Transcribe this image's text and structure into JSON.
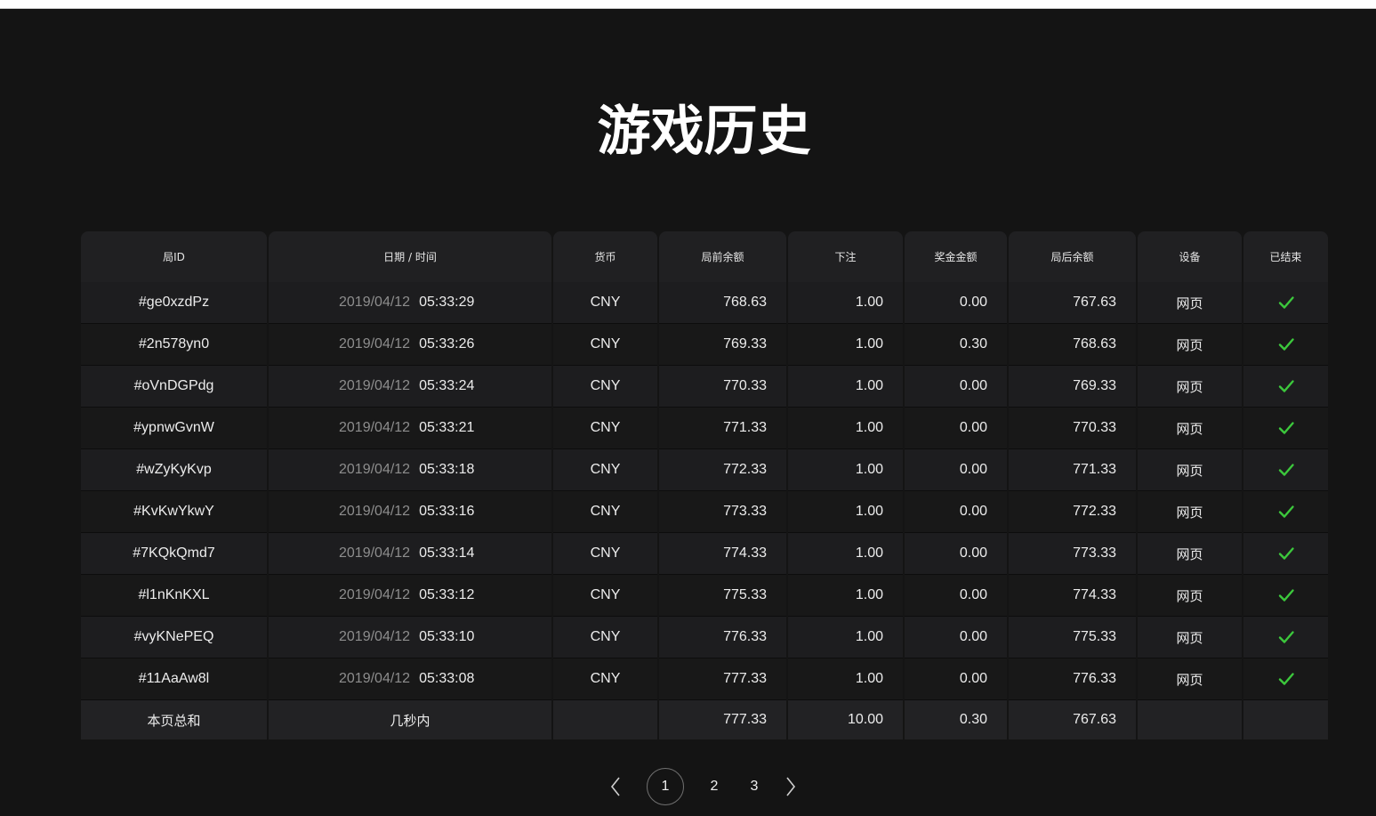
{
  "page": {
    "title": "游戏历史"
  },
  "table": {
    "headers": [
      "局ID",
      "日期 / 时间",
      "货币",
      "局前余额",
      "下注",
      "奖金金额",
      "局后余额",
      "设备",
      "已结束"
    ],
    "rows": [
      {
        "id": "#ge0xzdPz",
        "date": "2019/04/12",
        "time": "05:33:29",
        "currency": "CNY",
        "before": "768.63",
        "bet": "1.00",
        "win": "0.00",
        "after": "767.63",
        "device": "网页"
      },
      {
        "id": "#2n578yn0",
        "date": "2019/04/12",
        "time": "05:33:26",
        "currency": "CNY",
        "before": "769.33",
        "bet": "1.00",
        "win": "0.30",
        "after": "768.63",
        "device": "网页"
      },
      {
        "id": "#oVnDGPdg",
        "date": "2019/04/12",
        "time": "05:33:24",
        "currency": "CNY",
        "before": "770.33",
        "bet": "1.00",
        "win": "0.00",
        "after": "769.33",
        "device": "网页"
      },
      {
        "id": "#ypnwGvnW",
        "date": "2019/04/12",
        "time": "05:33:21",
        "currency": "CNY",
        "before": "771.33",
        "bet": "1.00",
        "win": "0.00",
        "after": "770.33",
        "device": "网页"
      },
      {
        "id": "#wZyKyKvp",
        "date": "2019/04/12",
        "time": "05:33:18",
        "currency": "CNY",
        "before": "772.33",
        "bet": "1.00",
        "win": "0.00",
        "after": "771.33",
        "device": "网页"
      },
      {
        "id": "#KvKwYkwY",
        "date": "2019/04/12",
        "time": "05:33:16",
        "currency": "CNY",
        "before": "773.33",
        "bet": "1.00",
        "win": "0.00",
        "after": "772.33",
        "device": "网页"
      },
      {
        "id": "#7KQkQmd7",
        "date": "2019/04/12",
        "time": "05:33:14",
        "currency": "CNY",
        "before": "774.33",
        "bet": "1.00",
        "win": "0.00",
        "after": "773.33",
        "device": "网页"
      },
      {
        "id": "#l1nKnKXL",
        "date": "2019/04/12",
        "time": "05:33:12",
        "currency": "CNY",
        "before": "775.33",
        "bet": "1.00",
        "win": "0.00",
        "after": "774.33",
        "device": "网页"
      },
      {
        "id": "#vyKNePEQ",
        "date": "2019/04/12",
        "time": "05:33:10",
        "currency": "CNY",
        "before": "776.33",
        "bet": "1.00",
        "win": "0.00",
        "after": "775.33",
        "device": "网页"
      },
      {
        "id": "#11AaAw8l",
        "date": "2019/04/12",
        "time": "05:33:08",
        "currency": "CNY",
        "before": "777.33",
        "bet": "1.00",
        "win": "0.00",
        "after": "776.33",
        "device": "网页"
      }
    ],
    "finished_icon": "checkmark-icon",
    "finished_color": "#3cc83c",
    "footer": {
      "label": "本页总和",
      "time": "几秒内",
      "currency": "",
      "before": "777.33",
      "bet": "10.00",
      "win": "0.30",
      "after": "767.63",
      "device": "",
      "finished": ""
    }
  },
  "pagination": {
    "prev_icon": "chevron-left-icon",
    "next_icon": "chevron-right-icon",
    "pages": [
      "1",
      "2",
      "3"
    ],
    "current": "1"
  }
}
